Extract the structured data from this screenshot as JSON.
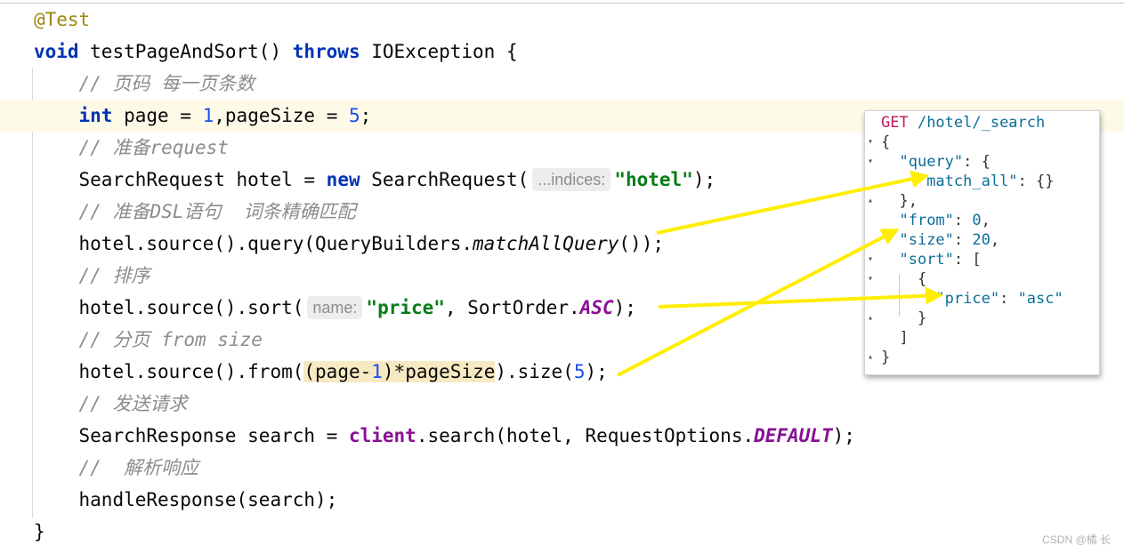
{
  "code": {
    "annotation": "@Test",
    "line2": {
      "kw_void": "void",
      "method": " testPageAndSort() ",
      "kw_throws": "throws",
      "rest": " IOException {"
    },
    "comment_page": "// 页码 每一页条数",
    "line4": {
      "kw_int": "int",
      "a": " page = ",
      "n1": "1",
      "b": ",pageSize = ",
      "n2": "5",
      "c": ";"
    },
    "comment_request": "// 准备request",
    "line6": {
      "a": "SearchRequest hotel = ",
      "kw_new": "new",
      "b": " SearchRequest(",
      "hint": "...indices:",
      "str": "\"hotel\"",
      "c": ");"
    },
    "comment_dsl": "// 准备DSL语句  词条精确匹配",
    "line8": {
      "a": "hotel.source().query(QueryBuilders.",
      "static": "matchAllQuery",
      "b": "());"
    },
    "comment_sort": "// 排序",
    "line10": {
      "a": "hotel.source().sort(",
      "hint": "name:",
      "str": "\"price\"",
      "b": ", SortOrder.",
      "const": "ASC",
      "c": ");"
    },
    "comment_from_size": "// 分页 from size",
    "line12": {
      "a": "hotel.source().from(",
      "hl_a": "(page-",
      "hl_n": "1",
      "hl_b": ")*pageSize",
      "b": ").size(",
      "n": "5",
      "c": ");"
    },
    "comment_send": "// 发送请求",
    "line14": {
      "a": "SearchResponse search = ",
      "field": "client",
      "b": ".search(hotel, RequestOptions.",
      "const": "DEFAULT",
      "c": ");"
    },
    "comment_parse": "//  解析响应",
    "line16": "handleResponse(search);",
    "closing": "}"
  },
  "popup": {
    "method": "GET",
    "path": " /hotel/_search",
    "open_brace": "{",
    "query_key": "\"query\"",
    "query_rest": ": {",
    "match_all_key": "\"match_all\"",
    "match_all_rest": ": {}",
    "query_close": "},",
    "from_key": "\"from\"",
    "from_sep": ": ",
    "from_val": "0",
    "from_comma": ",",
    "size_key": "\"size\"",
    "size_sep": ": ",
    "size_val": "20",
    "size_comma": ",",
    "sort_key": "\"sort\"",
    "sort_rest": ": [",
    "inner_open": "{",
    "price_key": "\"price\"",
    "price_sep": ": ",
    "price_val": "\"asc\"",
    "inner_close": "}",
    "array_close": "]",
    "close_brace": "}"
  },
  "colors": {
    "arrow": "#ffee00",
    "keyword": "#0033b3",
    "string": "#067d17",
    "comment": "#8c8c8c"
  },
  "watermark": "CSDN @橘 长"
}
